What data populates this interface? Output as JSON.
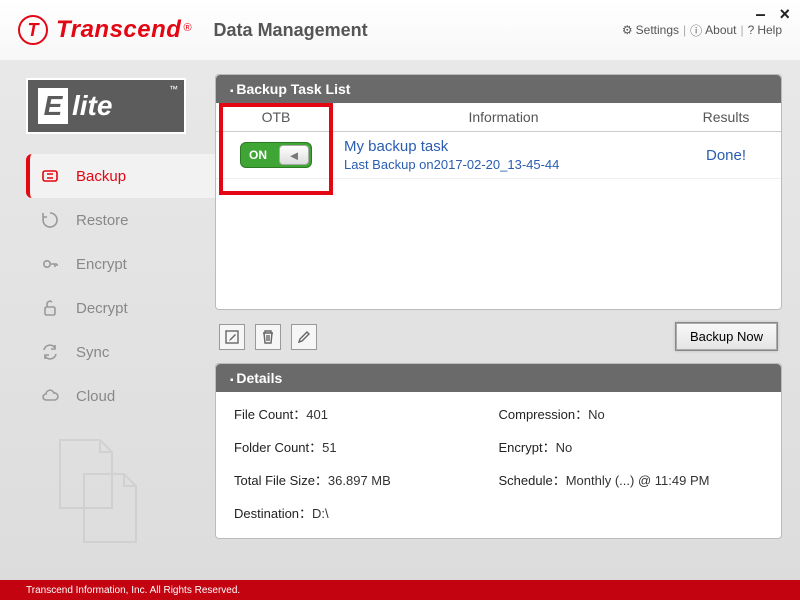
{
  "brand": {
    "name": "Transcend",
    "subtitle": "Data Management"
  },
  "menubar": {
    "settings": "Settings",
    "about": "About",
    "help": "Help"
  },
  "sidebar": {
    "logo_text": "lite",
    "items": [
      {
        "label": "Backup",
        "icon": "backup"
      },
      {
        "label": "Restore",
        "icon": "restore"
      },
      {
        "label": "Encrypt",
        "icon": "encrypt"
      },
      {
        "label": "Decrypt",
        "icon": "decrypt"
      },
      {
        "label": "Sync",
        "icon": "sync"
      },
      {
        "label": "Cloud",
        "icon": "cloud"
      }
    ],
    "active_index": 0
  },
  "task_list": {
    "title": "Backup Task List",
    "columns": {
      "otb": "OTB",
      "info": "Information",
      "results": "Results"
    },
    "rows": [
      {
        "otb_on": true,
        "otb_label": "ON",
        "name": "My backup task",
        "last_backup_prefix": "Last Backup on",
        "last_backup_time": "2017-02-20_13-45-44",
        "result": "Done!"
      }
    ]
  },
  "toolbar": {
    "backup_now": "Backup Now"
  },
  "details": {
    "title": "Details",
    "file_count_label": "File Count：",
    "file_count": "401",
    "compression_label": "Compression：",
    "compression": "No",
    "folder_count_label": "Folder Count：",
    "folder_count": "51",
    "encrypt_label": "Encrypt：",
    "encrypt": "No",
    "total_size_label": "Total File Size：",
    "total_size": "36.897 MB",
    "schedule_label": "Schedule：",
    "schedule": "Monthly (...) @ 11:49 PM",
    "destination_label": "Destination：",
    "destination": "D:\\"
  },
  "footer": "Transcend Information, Inc. All Rights Reserved."
}
